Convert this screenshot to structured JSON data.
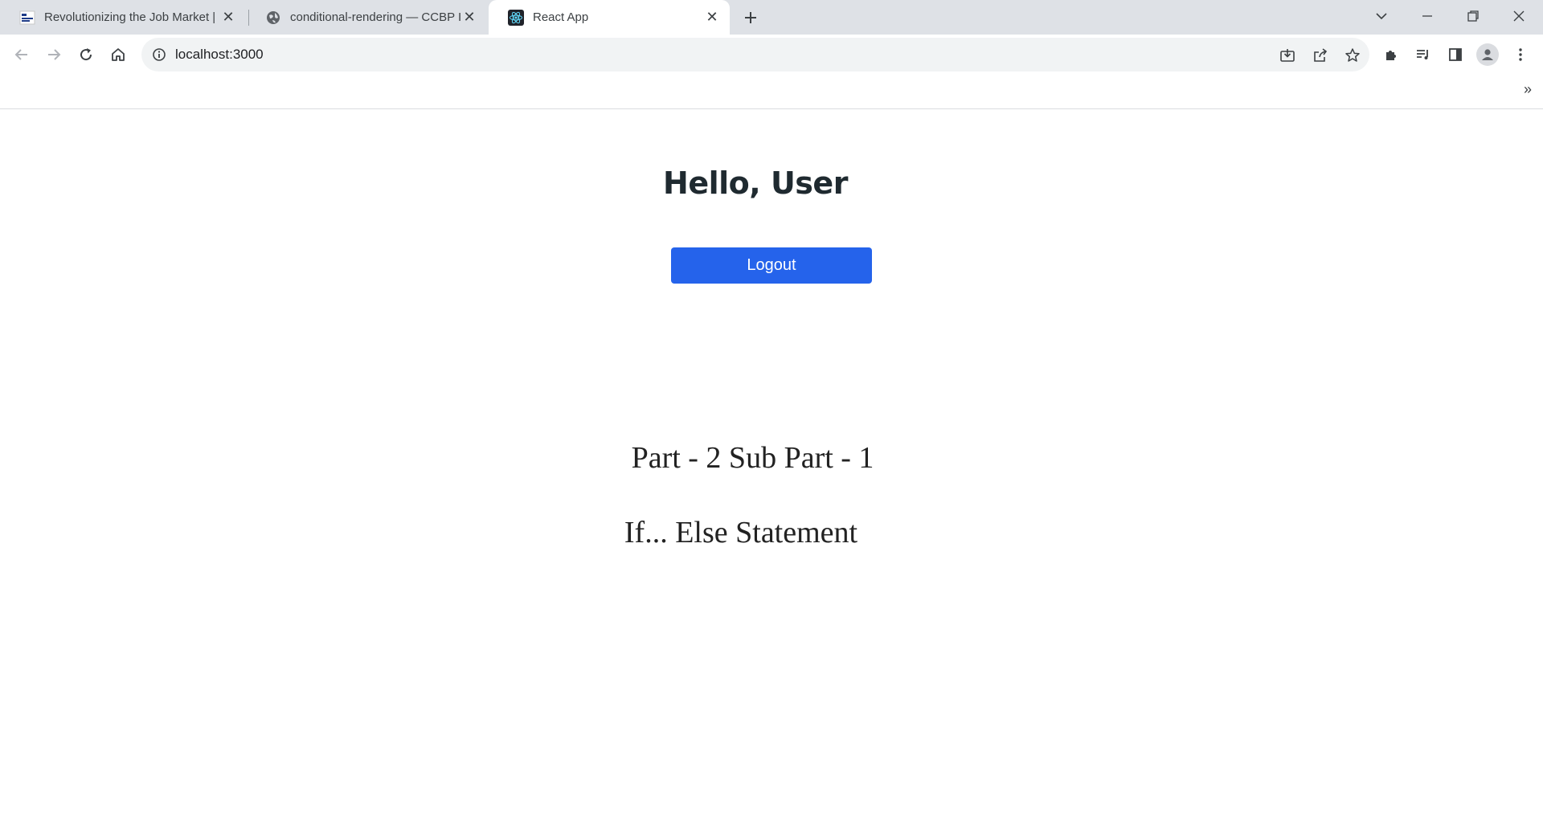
{
  "browser": {
    "tabs": [
      {
        "title": "Revolutionizing the Job Market |",
        "favicon": "nxtwave-logo",
        "active": false
      },
      {
        "title": "conditional-rendering — CCBP ID",
        "favicon": "globe-icon",
        "active": false
      },
      {
        "title": "React App",
        "favicon": "react-logo",
        "active": true
      }
    ],
    "address": {
      "url": "localhost:3000"
    }
  },
  "app": {
    "greeting": "Hello, User",
    "logout_label": "Logout",
    "part_title": "Part - 2 Sub Part - 1",
    "subtitle": "If... Else Statement"
  },
  "colors": {
    "button": "#2563eb",
    "tabstrip": "#dee1e6",
    "heading": "#1f2a30"
  }
}
